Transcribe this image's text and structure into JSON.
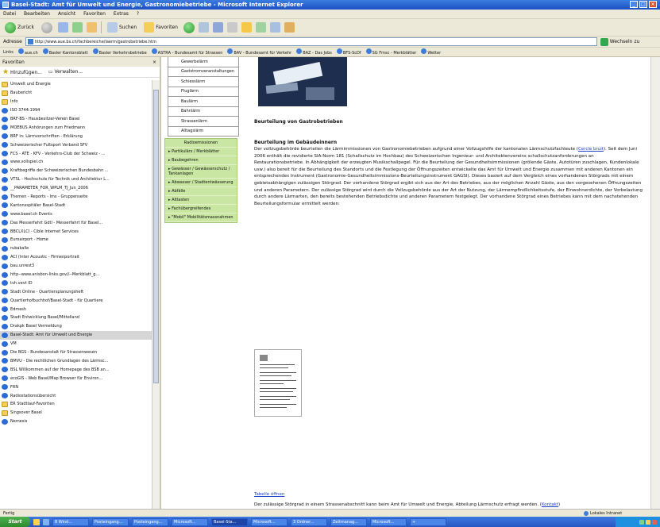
{
  "window": {
    "title": "Basel-Stadt: Amt für Umwelt und Energie, Gastronomiebetriebe - Microsoft Internet Explorer"
  },
  "menubar": [
    "Datei",
    "Bearbeiten",
    "Ansicht",
    "Favoriten",
    "Extras",
    "?"
  ],
  "toolbar": {
    "back": "Zurück",
    "search": "Suchen",
    "favorites": "Favoriten"
  },
  "address": {
    "label": "Adresse",
    "url": "http://www.aue.bs.ch/fachbereiche/laerm/gastrobetriebe.htm",
    "go": "Wechseln zu"
  },
  "links_bar": {
    "label": "Links",
    "items": [
      "aue.ch",
      "Basler Kantonsblatt",
      "Basler Verkehrsbetriebe",
      "ASTRA - Bundesamt für Strassen",
      "BAV - Bundesamt für Verkehr",
      "BAZ - Das Jobs",
      "BFS-ScDf",
      "SG Fmsc - Merkblätter",
      "Wetter"
    ]
  },
  "favorites": {
    "header": "Favoriten",
    "add": "Hinzufügen...",
    "organize": "Verwalten...",
    "items": [
      {
        "label": "Umwelt und Energie",
        "type": "folder"
      },
      {
        "label": "Baubericht",
        "type": "folder"
      },
      {
        "label": "Info",
        "type": "folder"
      },
      {
        "label": "ISO 3744:1994",
        "type": "link"
      },
      {
        "label": "BRF-BS - Hausbesitzer-Verein Basel",
        "type": "link"
      },
      {
        "label": "MOEBUS Anhörungen zum Friedmann",
        "type": "link"
      },
      {
        "label": "BRF in: Lärmvorschriften - Erklärung",
        "type": "link"
      },
      {
        "label": "Schweizerischer Fußsport Verband SFV",
        "type": "link"
      },
      {
        "label": "FCS - ATE - KFV - Verkehrs-Club der Schweiz - ...",
        "type": "link"
      },
      {
        "label": "www.vollspiel.ch",
        "type": "link"
      },
      {
        "label": "Kraftbegriffe der Schweizerischen Bundesbahn ...",
        "type": "link"
      },
      {
        "label": "VTSL - Hochschule für Technik und Architektur L...",
        "type": "link"
      },
      {
        "label": "__PARAMETER_FOR_WPLM_TJ_Jun_2006",
        "type": "link"
      },
      {
        "label": "Themen - Reports - Ims - Gruppenseite",
        "type": "link"
      },
      {
        "label": "Kantonsspitäler Basel-Stadt",
        "type": "link"
      },
      {
        "label": "www.basel.ch Events",
        "type": "link"
      },
      {
        "label": "Das Messerfahrt Gdtl - Messerfahrt für Basel...",
        "type": "link"
      },
      {
        "label": "BBCLXLCI - Cible Internet Services",
        "type": "link"
      },
      {
        "label": "Euroairport - Home",
        "type": "link"
      },
      {
        "label": "rubakalle",
        "type": "link"
      },
      {
        "label": "ACI (Inter Acoustic - Firmenportrait",
        "type": "link"
      },
      {
        "label": "bau.unrest3",
        "type": "link"
      },
      {
        "label": "http--www.anisbon-links.gov//--Merkblatt_g...",
        "type": "link"
      },
      {
        "label": "tvh.vevt ID",
        "type": "link"
      },
      {
        "label": "Stadt Online - Quartiersplanungsheft",
        "type": "link"
      },
      {
        "label": "Quartierhofbuchhof/Basel-Stadt - für Quartiere",
        "type": "link"
      },
      {
        "label": "Edmesh",
        "type": "link"
      },
      {
        "label": "Stadt Entwicklung Basel/Mittelland",
        "type": "link"
      },
      {
        "label": "Drakpk Basel Vermeldung",
        "type": "link"
      },
      {
        "label": "Basel-Stadt: Amt für Umwelt und Energie",
        "type": "link",
        "selected": true
      },
      {
        "label": "VM",
        "type": "link"
      },
      {
        "label": "Die BGS - Bundesanstalt für Strassenwesen",
        "type": "link"
      },
      {
        "label": "BMVU - Die rechtlichen Grundlagen des Lärmsc...",
        "type": "link"
      },
      {
        "label": "BSL Willkommen auf der Homepage des BSB an...",
        "type": "link"
      },
      {
        "label": "ecoGIS - Web Basel/Map Browser für Environ...",
        "type": "link"
      },
      {
        "label": "FRN",
        "type": "link"
      },
      {
        "label": "Radiostationsübersicht",
        "type": "link"
      },
      {
        "label": "ER Stadtlauf-Favoriten",
        "type": "folder"
      },
      {
        "label": "Singsover Basel",
        "type": "folder"
      },
      {
        "label": "Nemesis",
        "type": "link"
      }
    ]
  },
  "nav_menu": {
    "top_items": [
      "Gewerbelärm",
      "Gaststromveranstaltungen",
      "Schiesslärm",
      "Fluglärm",
      "Baulärm",
      "Bahnlärm",
      "Strassenlärm",
      "Alltagslärm"
    ],
    "green_items": [
      "Radioemissionen",
      "Partikulärs / Merkblätter",
      "Baubegehren",
      "Gewässer / Gewässerschutz / Tankanlagen",
      "Abwasser / Stadtentwässerung",
      "Abfälle",
      "Altlasten",
      "Fachübergreifendes",
      "\"Mobil\" Mobilitätsmassnahmen"
    ]
  },
  "article": {
    "heading": "Beurteilung von Gastrobetrieben",
    "subheading": "Beurteilung im Gebäudeinnern",
    "body_before": "Der vollzugsbehörde beurteilen die Lärmimmissionen von Gastronomiebetrieben aufgrund einer Vollzugshilfe der kantonalen Lärmschutzfachleute (",
    "body_link": "Cercle bruit",
    "body_after": "). Seit dem Juni 2006 enthält die revidierte SIA-Norm 181 (Schallschutz im Hochbau) des Schweizerischen Ingenieur- und Architektenvereins schallschutzanforderungen an Restaurationsbetriebe. In Abhängigkeit der erzeugten Musikschallpegel. Für die Beurteilung der Gesundheitsimmissionen (grölende Gäste, Autotüren zuschlagen, Kundenlokale usw.) also bereit für die Beurteilung des Standorts und die Festlegung der Öffnungszeiten entwickelte das Amt für Umwelt und Energie zusammen mit anderen Kantonen ein entsprechendes Instrument (Gastronomie-Gesundheitsimmissions-Beurteilungsinstrument GAGSI). Dieses basiert auf dem Vergleich eines vorhandenen Störgrads mit einem gebietsabhängigen zulässigen Störgrad. Der vorhandene Störgrad ergibt sich aus der Art des Betriebes, aus der möglichen Anzahl Gäste, aus den vorgesehenen Öffnungszeiten und anderen Parametern. Der zulässige Störgrad wird durch die Vollzugsbehörde aus der Art der Nutzung, der Lärmempfindlichkeitsstufe, der Einwohnerdichte, der Vorbelastung durch andere Lärmarten, den bereits bestehenden Betriebsdichte und anderen Parametern festgelegt. Der vorhandene Störgrad eines Betriebes kann mit dem nachstehenden Beurteilungsformular ermittelt werden:",
    "table_link": "Tabelle öffnen",
    "bottom_before": "Der zulässige Störgrad in einem Strassenabschnitt kann beim Amt für Umwelt und Energie, Abteilung Lärmschutz erfragt werden. (",
    "bottom_link": "Kontakt",
    "bottom_after": ")"
  },
  "statusbar": {
    "left": "Fertig",
    "zone": "Lokales Intranet"
  },
  "taskbar": {
    "start": "Start",
    "buttons": [
      "8 Wind...",
      "Posteingang...",
      "Posteingang...",
      "Microsoft...",
      "Basel-Sta...",
      "Microsoft...",
      "3 Ordner...",
      "Zeitmanag...",
      "Microsoft...",
      "+"
    ],
    "active_index": 4
  },
  "colors": {
    "nav_green": "#c9e7a2",
    "link": "#1a3fcc",
    "title_blue": "#1c4fc4"
  }
}
